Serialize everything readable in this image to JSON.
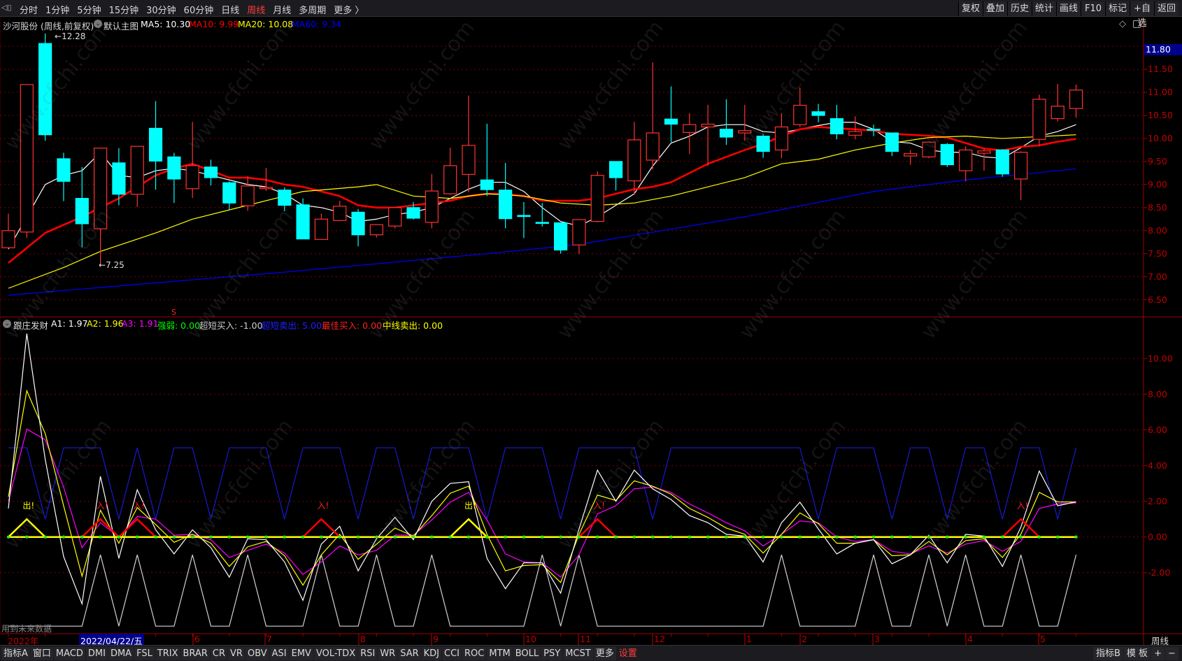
{
  "toolbar": {
    "periods": [
      "分时",
      "1分钟",
      "5分钟",
      "15分钟",
      "30分钟",
      "60分钟",
      "日线",
      "周线",
      "月线",
      "多周期",
      "更多 〉"
    ],
    "active_period": "周线",
    "buttons": [
      "复权",
      "叠加",
      "历史",
      "统计",
      "画线",
      "F10",
      "标记",
      "+自选",
      "返回"
    ]
  },
  "info": {
    "stock": "沙河股份 (周线,前复权)",
    "template": "默认主图",
    "ma5": "MA5: 10.30",
    "ma10": "MA10: 9.99",
    "ma20": "MA20: 10.08",
    "ma60": "MA60: 9.34"
  },
  "price_axis": {
    "labels": [
      "11.50",
      "11.00",
      "10.50",
      "10.00",
      "9.50",
      "9.00",
      "8.50",
      "8.00",
      "7.50",
      "7.00",
      "6.50"
    ],
    "current": "11.80",
    "high_label": "12.28",
    "low_label": "7.25"
  },
  "indicator": {
    "name": "跟庄发财",
    "a1": "A1: 1.97",
    "a2": "A2: 1.96",
    "a3": "A3: 1.91",
    "qiangruo": "强弱: 0.00",
    "cdmr": "超短买入: -1.00",
    "cdmc": "超短卖出: 5.00",
    "zjmr": "最佳买入: 0.00",
    "zxmc": "中线卖出: 0.00",
    "marker": "S",
    "signal_out": "出!",
    "signal_in": "入!",
    "future_note": "用到未来数据",
    "axis": [
      "10.00",
      "8.00",
      "6.00",
      "4.00",
      "2.00",
      "0.00",
      "-2.00"
    ]
  },
  "date_axis": {
    "year": "2022年",
    "cursor": "2022/04/22/五",
    "months": [
      "6",
      "7",
      "8",
      "9",
      "10",
      "11",
      "12",
      "1",
      "2",
      "3",
      "4",
      "5"
    ],
    "period": "周线"
  },
  "bottom": {
    "tabs": [
      "指标A",
      "窗口",
      "MACD",
      "DMI",
      "DMA",
      "FSL",
      "TRIX",
      "BRAR",
      "CR",
      "VR",
      "OBV",
      "ASI",
      "EMV",
      "VOL-TDX",
      "RSI",
      "WR",
      "SAR",
      "KDJ",
      "CCI",
      "ROC",
      "MTM",
      "BOLL",
      "PSY",
      "MCST",
      "更多",
      "设置"
    ],
    "right": [
      "指标B",
      "模 板",
      "+",
      "−"
    ]
  },
  "watermark": "www.cfchi.com",
  "colors": {
    "up": "#ff3232",
    "down": "#00ffff",
    "ma5": "#ffffff",
    "ma10": "#ff0000",
    "ma20": "#ffff00",
    "ma60": "#0000ff",
    "a1": "#ffffff",
    "a2": "#ffff00",
    "a3": "#ff00ff"
  },
  "chart_data": {
    "type": "candlestick",
    "title": "沙河股份 周线",
    "ylim": [
      6.5,
      12.0
    ],
    "candles": [
      [
        7.63,
        8.37,
        7.63,
        8.0
      ],
      [
        7.97,
        11.17,
        7.84,
        11.17
      ],
      [
        12.06,
        12.28,
        9.95,
        10.08
      ],
      [
        9.56,
        9.69,
        8.64,
        9.07
      ],
      [
        8.7,
        9.38,
        7.64,
        8.15
      ],
      [
        8.04,
        9.79,
        7.25,
        9.79
      ],
      [
        9.47,
        9.79,
        8.55,
        8.79
      ],
      [
        8.79,
        9.83,
        8.51,
        9.83
      ],
      [
        10.22,
        10.81,
        8.89,
        9.51
      ],
      [
        9.6,
        9.69,
        8.6,
        9.12
      ],
      [
        8.91,
        10.36,
        8.71,
        9.41
      ],
      [
        9.38,
        9.54,
        8.98,
        9.15
      ],
      [
        9.04,
        9.07,
        8.45,
        8.6
      ],
      [
        8.54,
        9.18,
        8.43,
        8.97
      ],
      [
        8.91,
        9.36,
        8.86,
        8.94
      ],
      [
        8.88,
        8.94,
        8.42,
        8.55
      ],
      [
        8.56,
        8.7,
        7.82,
        7.82
      ],
      [
        7.81,
        8.37,
        7.81,
        8.25
      ],
      [
        8.22,
        8.65,
        8.22,
        8.53
      ],
      [
        8.4,
        8.47,
        7.66,
        7.91
      ],
      [
        7.91,
        8.13,
        7.85,
        8.13
      ],
      [
        8.1,
        8.5,
        8.05,
        8.5
      ],
      [
        8.5,
        8.62,
        8.24,
        8.27
      ],
      [
        8.18,
        9.23,
        8.05,
        8.86
      ],
      [
        8.8,
        9.8,
        8.78,
        9.41
      ],
      [
        9.22,
        10.93,
        8.83,
        9.85
      ],
      [
        9.1,
        10.32,
        8.75,
        8.89
      ],
      [
        8.88,
        9.47,
        8.05,
        8.26
      ],
      [
        8.33,
        8.62,
        7.84,
        8.33
      ],
      [
        8.18,
        8.6,
        8.09,
        8.18
      ],
      [
        8.17,
        8.18,
        7.5,
        7.58
      ],
      [
        7.69,
        8.25,
        7.49,
        8.24
      ],
      [
        8.2,
        9.29,
        8.18,
        9.2
      ],
      [
        9.5,
        9.5,
        8.87,
        9.15
      ],
      [
        9.08,
        10.36,
        8.78,
        9.97
      ],
      [
        9.53,
        11.65,
        9.33,
        10.12
      ],
      [
        10.42,
        11.13,
        9.92,
        10.31
      ],
      [
        10.13,
        10.55,
        9.66,
        10.3
      ],
      [
        10.25,
        10.73,
        9.41,
        10.31
      ],
      [
        10.2,
        10.85,
        9.86,
        10.03
      ],
      [
        10.12,
        10.73,
        9.95,
        10.17
      ],
      [
        10.05,
        10.1,
        9.58,
        9.72
      ],
      [
        9.75,
        10.55,
        9.57,
        10.25
      ],
      [
        10.3,
        11.1,
        10.25,
        10.72
      ],
      [
        10.58,
        10.75,
        10.35,
        10.5
      ],
      [
        10.43,
        10.73,
        9.98,
        10.1
      ],
      [
        10.07,
        10.48,
        9.98,
        10.15
      ],
      [
        10.2,
        10.3,
        10.05,
        10.18
      ],
      [
        10.12,
        10.12,
        9.62,
        9.72
      ],
      [
        9.62,
        9.75,
        9.43,
        9.67
      ],
      [
        9.6,
        9.92,
        9.57,
        9.92
      ],
      [
        9.87,
        9.9,
        9.38,
        9.43
      ],
      [
        9.3,
        9.83,
        9.07,
        9.75
      ],
      [
        9.68,
        9.78,
        9.3,
        9.73
      ],
      [
        9.75,
        9.77,
        9.17,
        9.23
      ],
      [
        9.12,
        9.72,
        8.66,
        9.7
      ],
      [
        9.98,
        10.95,
        9.83,
        10.85
      ],
      [
        10.43,
        11.18,
        10.37,
        10.7
      ],
      [
        10.65,
        11.17,
        10.45,
        11.05
      ]
    ],
    "candle_fields": [
      "open",
      "high",
      "low",
      "close"
    ],
    "ma": [
      {
        "name": "MA5",
        "points": [
          [
            0,
            7.6
          ],
          [
            1,
            8.3
          ],
          [
            2,
            9.0
          ],
          [
            3,
            9.2
          ],
          [
            4,
            9.3
          ],
          [
            5,
            9.7
          ],
          [
            6,
            9.2
          ],
          [
            7,
            9.15
          ],
          [
            8,
            9.3
          ],
          [
            9,
            9.35
          ],
          [
            10,
            9.3
          ],
          [
            11,
            9.2
          ],
          [
            12,
            9.1
          ],
          [
            13,
            9.0
          ],
          [
            14,
            8.95
          ],
          [
            15,
            8.8
          ],
          [
            16,
            8.55
          ],
          [
            17,
            8.5
          ],
          [
            18,
            8.4
          ],
          [
            19,
            8.2
          ],
          [
            20,
            8.25
          ],
          [
            21,
            8.35
          ],
          [
            22,
            8.4
          ],
          [
            23,
            8.5
          ],
          [
            24,
            8.7
          ],
          [
            25,
            8.9
          ],
          [
            26,
            9.05
          ],
          [
            27,
            9.05
          ],
          [
            28,
            8.85
          ],
          [
            29,
            8.5
          ],
          [
            30,
            8.2
          ],
          [
            31,
            8.1
          ],
          [
            32,
            8.3
          ],
          [
            33,
            8.55
          ],
          [
            34,
            8.8
          ],
          [
            35,
            9.4
          ],
          [
            36,
            9.9
          ],
          [
            37,
            10.05
          ],
          [
            38,
            10.25
          ],
          [
            39,
            10.3
          ],
          [
            40,
            10.3
          ],
          [
            41,
            10.15
          ],
          [
            42,
            10.12
          ],
          [
            43,
            10.2
          ],
          [
            44,
            10.28
          ],
          [
            45,
            10.35
          ],
          [
            46,
            10.35
          ],
          [
            47,
            10.2
          ],
          [
            48,
            9.93
          ],
          [
            49,
            9.9
          ],
          [
            50,
            9.75
          ],
          [
            51,
            9.7
          ],
          [
            52,
            9.7
          ],
          [
            53,
            9.6
          ],
          [
            54,
            9.57
          ],
          [
            55,
            9.8
          ],
          [
            56,
            10.05
          ],
          [
            57,
            10.15
          ],
          [
            58,
            10.3
          ]
        ]
      },
      {
        "name": "MA10",
        "points": [
          [
            0,
            7.3
          ],
          [
            2,
            7.95
          ],
          [
            4,
            8.3
          ],
          [
            6,
            8.7
          ],
          [
            8,
            9.2
          ],
          [
            9,
            9.35
          ],
          [
            10,
            9.45
          ],
          [
            11,
            9.3
          ],
          [
            12,
            9.15
          ],
          [
            13,
            9.15
          ],
          [
            14,
            9.1
          ],
          [
            15,
            9.0
          ],
          [
            16,
            8.95
          ],
          [
            17,
            8.85
          ],
          [
            18,
            8.75
          ],
          [
            19,
            8.55
          ],
          [
            20,
            8.5
          ],
          [
            21,
            8.5
          ],
          [
            22,
            8.55
          ],
          [
            23,
            8.6
          ],
          [
            24,
            8.65
          ],
          [
            25,
            8.75
          ],
          [
            26,
            8.8
          ],
          [
            27,
            8.8
          ],
          [
            28,
            8.75
          ],
          [
            29,
            8.65
          ],
          [
            30,
            8.65
          ],
          [
            31,
            8.65
          ],
          [
            32,
            8.7
          ],
          [
            33,
            8.8
          ],
          [
            34,
            8.9
          ],
          [
            35,
            8.95
          ],
          [
            36,
            9.05
          ],
          [
            37,
            9.25
          ],
          [
            38,
            9.45
          ],
          [
            39,
            9.6
          ],
          [
            40,
            9.75
          ],
          [
            41,
            9.88
          ],
          [
            42,
            10.05
          ],
          [
            43,
            10.2
          ],
          [
            44,
            10.25
          ],
          [
            45,
            10.22
          ],
          [
            46,
            10.2
          ],
          [
            47,
            10.17
          ],
          [
            48,
            10.1
          ],
          [
            49,
            10.08
          ],
          [
            50,
            10.06
          ],
          [
            51,
            10.02
          ],
          [
            52,
            9.9
          ],
          [
            53,
            9.78
          ],
          [
            54,
            9.74
          ],
          [
            55,
            9.82
          ],
          [
            56,
            9.85
          ],
          [
            57,
            9.93
          ],
          [
            58,
            9.99
          ]
        ]
      },
      {
        "name": "MA20",
        "points": [
          [
            0,
            6.75
          ],
          [
            3,
            7.2
          ],
          [
            5,
            7.55
          ],
          [
            8,
            7.95
          ],
          [
            10,
            8.25
          ],
          [
            13,
            8.55
          ],
          [
            16,
            8.85
          ],
          [
            19,
            8.95
          ],
          [
            20,
            9.0
          ],
          [
            22,
            8.75
          ],
          [
            24,
            8.7
          ],
          [
            26,
            8.8
          ],
          [
            28,
            8.75
          ],
          [
            30,
            8.6
          ],
          [
            32,
            8.55
          ],
          [
            34,
            8.6
          ],
          [
            36,
            8.75
          ],
          [
            38,
            8.95
          ],
          [
            40,
            9.15
          ],
          [
            42,
            9.45
          ],
          [
            44,
            9.55
          ],
          [
            46,
            9.75
          ],
          [
            48,
            9.9
          ],
          [
            50,
            10.02
          ],
          [
            52,
            10.05
          ],
          [
            54,
            10.0
          ],
          [
            56,
            10.04
          ],
          [
            58,
            10.08
          ]
        ]
      },
      {
        "name": "MA60",
        "points": [
          [
            0,
            6.6
          ],
          [
            15,
            7.1
          ],
          [
            26,
            7.5
          ],
          [
            31,
            7.7
          ],
          [
            40,
            8.3
          ],
          [
            47,
            8.85
          ],
          [
            52,
            9.1
          ],
          [
            58,
            9.34
          ]
        ]
      }
    ],
    "indicator": {
      "ylim": [
        -5.5,
        11.5
      ],
      "A1": [
        1.6,
        11.4,
        4.35,
        -1.1,
        -3.75,
        3.4,
        -1.2,
        2.65,
        0.4,
        -0.95,
        0.4,
        -0.6,
        -2.25,
        -0.1,
        -0.15,
        -1.4,
        -3.55,
        -0.4,
        0.6,
        -1.9,
        -0.1,
        1.1,
        -0.15,
        2.0,
        3.0,
        3.1,
        -1.2,
        -2.9,
        -1.45,
        -1.45,
        -3.15,
        0.45,
        3.75,
        2.0,
        3.75,
        2.7,
        2.1,
        1.2,
        0.8,
        0.15,
        0.05,
        -1.4,
        0.8,
        1.95,
        0.45,
        -0.95,
        -0.35,
        -0.15,
        -1.5,
        -1.0,
        0.1,
        -1.45,
        0.15,
        0.05,
        -1.65,
        0.55,
        3.7,
        1.75,
        1.97
      ],
      "A2": [
        2.25,
        8.2,
        5.8,
        1.75,
        -2.2,
        1.5,
        -0.35,
        1.65,
        0.7,
        -0.3,
        0.15,
        -0.35,
        -1.65,
        -0.55,
        -0.25,
        -1.05,
        -2.7,
        -1.0,
        0.15,
        -1.25,
        -0.4,
        0.5,
        0.05,
        1.2,
        2.45,
        2.85,
        0.15,
        -1.9,
        -1.6,
        -1.55,
        -2.55,
        0.15,
        2.35,
        2.05,
        3.15,
        2.85,
        2.4,
        1.6,
        1.1,
        0.5,
        0.15,
        -0.9,
        0.15,
        1.35,
        0.75,
        -0.35,
        -0.35,
        -0.15,
        -1.05,
        -1.0,
        -0.25,
        -1.0,
        -0.2,
        -0.1,
        -1.15,
        0.15,
        2.5,
        1.97,
        1.96
      ],
      "A3": [
        2.0,
        6.05,
        5.45,
        2.8,
        -0.6,
        0.8,
        0.0,
        1.15,
        1.0,
        0.1,
        0.15,
        -0.15,
        -1.15,
        -0.75,
        -0.4,
        -0.9,
        -2.1,
        -1.4,
        -0.5,
        -1.0,
        -0.75,
        0.1,
        0.1,
        0.95,
        1.95,
        2.5,
        0.95,
        -0.95,
        -1.4,
        -1.45,
        -2.25,
        -1.0,
        1.3,
        1.75,
        2.7,
        2.8,
        2.5,
        1.85,
        1.35,
        0.8,
        0.35,
        -0.5,
        0.15,
        0.9,
        0.8,
        0.0,
        -0.25,
        -0.15,
        -0.8,
        -0.95,
        -0.5,
        -0.9,
        -0.4,
        -0.2,
        -0.8,
        -0.25,
        1.6,
        1.85,
        1.91
      ],
      "sell_short": [
        5,
        5,
        1,
        5,
        5,
        5,
        1,
        5,
        1,
        5,
        5,
        1,
        5,
        5,
        5,
        1,
        5,
        5,
        5,
        1,
        5,
        5,
        1,
        5,
        5,
        5,
        1,
        5,
        5,
        5,
        1,
        5,
        5,
        5,
        5,
        1,
        5,
        5,
        5,
        5,
        5,
        5,
        5,
        5,
        1,
        5,
        5,
        5,
        1,
        5,
        5,
        1,
        5,
        5,
        1,
        5,
        5,
        1,
        5
      ],
      "buy_short": [
        -5,
        -5,
        -5,
        -5,
        -5,
        -1,
        -5,
        -1,
        -5,
        -5,
        -1,
        -5,
        -5,
        -1,
        -5,
        -5,
        -5,
        -1,
        -5,
        -5,
        -1,
        -5,
        -5,
        -1,
        -5,
        -5,
        -5,
        -5,
        -5,
        -1,
        -5,
        -1,
        -5,
        -5,
        -5,
        -5,
        -5,
        -5,
        -5,
        -5,
        -5,
        -5,
        -1,
        -5,
        -5,
        -5,
        -5,
        -1,
        -5,
        -5,
        -1,
        -5,
        -1,
        -5,
        -5,
        -1,
        -5,
        -5,
        -1
      ],
      "signals_out": [
        1,
        25
      ],
      "signals_in": [
        5,
        7,
        17,
        32,
        55
      ]
    }
  }
}
